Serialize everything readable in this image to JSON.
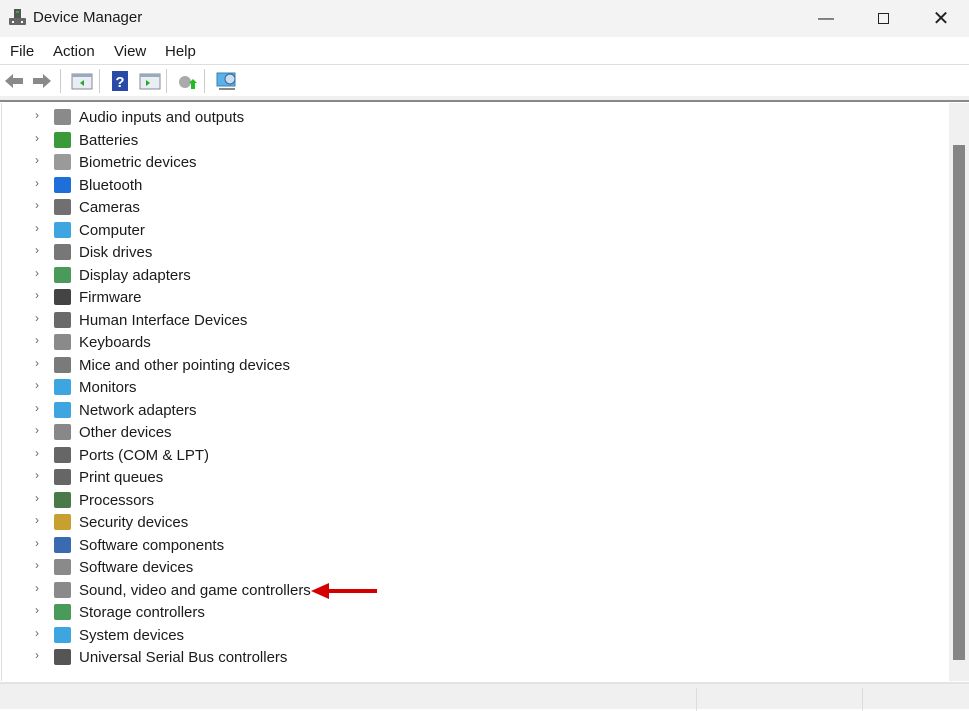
{
  "window": {
    "title": "Device Manager",
    "minimize_icon": "minimize-icon",
    "maximize_icon": "maximize-icon",
    "close_icon": "close-icon"
  },
  "menu": [
    "File",
    "Action",
    "View",
    "Help"
  ],
  "toolbar": [
    "back-icon",
    "forward-icon",
    "show-hide-console-tree-icon",
    "help-icon",
    "show-action-pane-icon",
    "update-driver-icon",
    "scan-hardware-icon"
  ],
  "tree": [
    {
      "label": "Audio inputs and outputs",
      "icon": "speaker-icon",
      "color": "#8a8a8a"
    },
    {
      "label": "Batteries",
      "icon": "battery-icon",
      "color": "#3a9a3a"
    },
    {
      "label": "Biometric devices",
      "icon": "fingerprint-icon",
      "color": "#9a9a9a"
    },
    {
      "label": "Bluetooth",
      "icon": "bluetooth-icon",
      "color": "#1e6fd9"
    },
    {
      "label": "Cameras",
      "icon": "camera-icon",
      "color": "#707070"
    },
    {
      "label": "Computer",
      "icon": "computer-icon",
      "color": "#3da5e0"
    },
    {
      "label": "Disk drives",
      "icon": "disk-icon",
      "color": "#777777"
    },
    {
      "label": "Display adapters",
      "icon": "display-adapter-icon",
      "color": "#4a9a5a"
    },
    {
      "label": "Firmware",
      "icon": "firmware-icon",
      "color": "#444444"
    },
    {
      "label": "Human Interface Devices",
      "icon": "hid-icon",
      "color": "#6a6a6a"
    },
    {
      "label": "Keyboards",
      "icon": "keyboard-icon",
      "color": "#8a8a8a"
    },
    {
      "label": "Mice and other pointing devices",
      "icon": "mouse-icon",
      "color": "#7a7a7a"
    },
    {
      "label": "Monitors",
      "icon": "monitor-icon",
      "color": "#3da5e0"
    },
    {
      "label": "Network adapters",
      "icon": "network-icon",
      "color": "#3da5e0"
    },
    {
      "label": "Other devices",
      "icon": "unknown-device-icon",
      "color": "#888888"
    },
    {
      "label": "Ports (COM & LPT)",
      "icon": "port-icon",
      "color": "#666666"
    },
    {
      "label": "Print queues",
      "icon": "printer-icon",
      "color": "#666666"
    },
    {
      "label": "Processors",
      "icon": "processor-icon",
      "color": "#4a7a4a"
    },
    {
      "label": "Security devices",
      "icon": "security-icon",
      "color": "#c8a030"
    },
    {
      "label": "Software components",
      "icon": "software-component-icon",
      "color": "#3a6ab0"
    },
    {
      "label": "Software devices",
      "icon": "software-device-icon",
      "color": "#8a8a8a"
    },
    {
      "label": "Sound, video and game controllers",
      "icon": "speaker-icon",
      "color": "#8a8a8a"
    },
    {
      "label": "Storage controllers",
      "icon": "storage-controller-icon",
      "color": "#4a9a5a"
    },
    {
      "label": "System devices",
      "icon": "system-devices-icon",
      "color": "#3da5e0"
    },
    {
      "label": "Universal Serial Bus controllers",
      "icon": "usb-icon",
      "color": "#555555"
    }
  ],
  "annotation": {
    "arrow_color": "#d40000",
    "target": "Sound, video and game controllers"
  }
}
